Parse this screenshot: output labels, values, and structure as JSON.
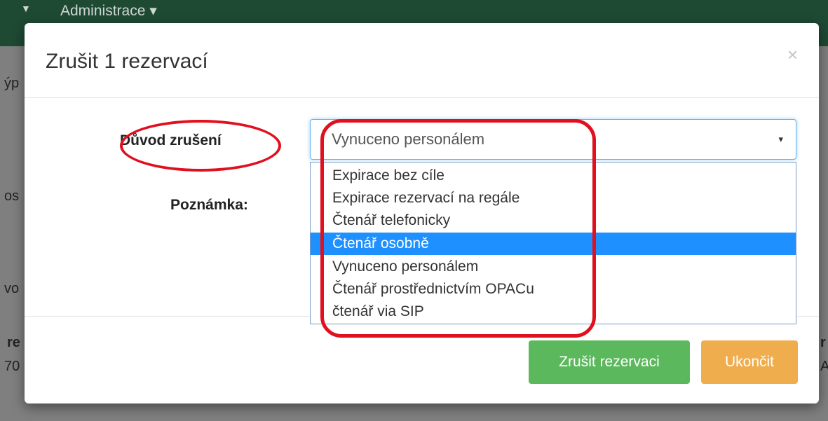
{
  "navbar": {
    "caret_icon": "caret-down-icon",
    "admin_label": "Administrace ▾"
  },
  "background": {
    "frag1": "ýp",
    "frag2": "os",
    "frag3": "vo",
    "frag4": "re",
    "frag5": "70",
    "frag6": "r",
    "frag7": "A"
  },
  "modal": {
    "title": "Zrušit 1 rezervací",
    "close_label": "×",
    "reason_label": "Důvod zrušení",
    "note_label": "Poznámka:",
    "select_value": "Vynuceno personálem",
    "select_arrow": "▾",
    "options": [
      "Expirace bez cíle",
      "Expirace rezervací na regále",
      "Čtenář telefonicky",
      "Čtenář osobně",
      "Vynuceno personálem",
      "Čtenář prostřednictvím OPACu",
      "čtenář via SIP"
    ],
    "highlighted_option": "Čtenář osobně",
    "cancel_reservation_label": "Zrušit rezervaci",
    "close_button_label": "Ukončit"
  },
  "colors": {
    "navbar": "#1e4a34",
    "accent_blue": "#1e90ff",
    "success": "#5cb85c",
    "warning": "#f0ad4e",
    "annotation": "#e0101e"
  }
}
